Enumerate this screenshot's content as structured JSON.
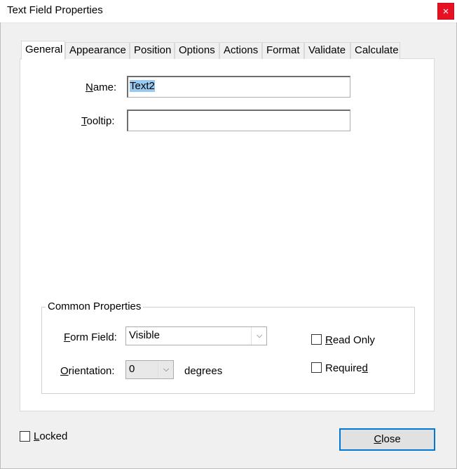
{
  "window": {
    "title": "Text Field Properties",
    "close_glyph": "×"
  },
  "tabs": [
    {
      "label": "General",
      "active": true
    },
    {
      "label": "Appearance",
      "active": false
    },
    {
      "label": "Position",
      "active": false
    },
    {
      "label": "Options",
      "active": false
    },
    {
      "label": "Actions",
      "active": false
    },
    {
      "label": "Format",
      "active": false
    },
    {
      "label": "Validate",
      "active": false
    },
    {
      "label": "Calculate",
      "active": false
    }
  ],
  "general": {
    "name_label_mnemonic": "N",
    "name_label_rest": "ame:",
    "name_value": "Text2",
    "tooltip_label_mnemonic": "T",
    "tooltip_label_rest": "ooltip:",
    "tooltip_value": ""
  },
  "common_properties": {
    "group_title": "Common Properties",
    "form_field_label_mnemonic": "F",
    "form_field_label_rest": "orm Field:",
    "form_field_value": "Visible",
    "orientation_label_mnemonic": "O",
    "orientation_label_rest": "rientation:",
    "orientation_value": "0",
    "degrees_label": "degrees",
    "read_only_mnemonic": "R",
    "read_only_rest": "ead Only",
    "read_only_checked": false,
    "required_prefix": "Require",
    "required_mnemonic": "d",
    "required_checked": false
  },
  "footer": {
    "locked_mnemonic": "L",
    "locked_rest": "ocked",
    "locked_checked": false,
    "close_mnemonic": "C",
    "close_rest": "lose"
  },
  "icons": {
    "dropdown_arrow": "chevron-down-icon",
    "close": "close-icon"
  },
  "colors": {
    "close_button_red": "#e81123",
    "focus_border_blue": "#0078d7",
    "selection_highlight": "#99c9ef"
  }
}
